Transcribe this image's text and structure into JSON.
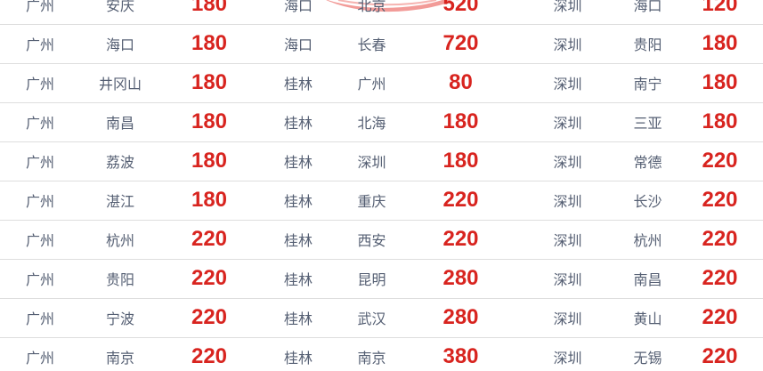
{
  "fare_table": {
    "rows": [
      [
        "广州",
        "安庆",
        "180",
        "海口",
        "北京",
        "520",
        "深圳",
        "海口",
        "120"
      ],
      [
        "广州",
        "海口",
        "180",
        "海口",
        "长春",
        "720",
        "深圳",
        "贵阳",
        "180"
      ],
      [
        "广州",
        "井冈山",
        "180",
        "桂林",
        "广州",
        "80",
        "深圳",
        "南宁",
        "180"
      ],
      [
        "广州",
        "南昌",
        "180",
        "桂林",
        "北海",
        "180",
        "深圳",
        "三亚",
        "180"
      ],
      [
        "广州",
        "荔波",
        "180",
        "桂林",
        "深圳",
        "180",
        "深圳",
        "常德",
        "220"
      ],
      [
        "广州",
        "湛江",
        "180",
        "桂林",
        "重庆",
        "220",
        "深圳",
        "长沙",
        "220"
      ],
      [
        "广州",
        "杭州",
        "220",
        "桂林",
        "西安",
        "220",
        "深圳",
        "杭州",
        "220"
      ],
      [
        "广州",
        "贵阳",
        "220",
        "桂林",
        "昆明",
        "280",
        "深圳",
        "南昌",
        "220"
      ],
      [
        "广州",
        "宁波",
        "220",
        "桂林",
        "武汉",
        "280",
        "深圳",
        "黄山",
        "220"
      ],
      [
        "广州",
        "南京",
        "220",
        "桂林",
        "南京",
        "380",
        "深圳",
        "无锡",
        "220"
      ]
    ]
  },
  "colors": {
    "city_text": "#555f73",
    "price_text": "#d8241f",
    "row_divider": "#dedede",
    "decoration": "#f08a86"
  }
}
